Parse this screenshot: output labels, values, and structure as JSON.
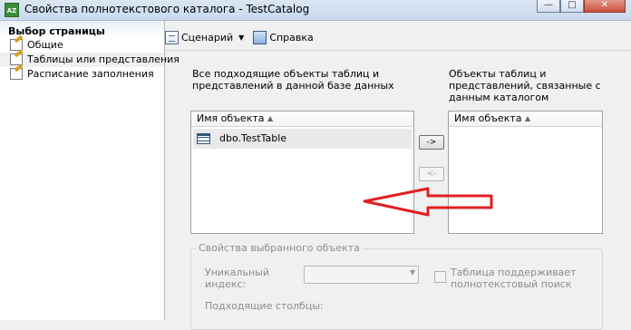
{
  "window": {
    "title": "Свойства полнотекстового каталога - TestCatalog",
    "app_icon_text": "AZ",
    "minimize_glyph": "—",
    "maximize_glyph": "□",
    "close_glyph": "✕"
  },
  "sidebar": {
    "header": "Выбор страницы",
    "items": [
      {
        "label": "Общие",
        "icon": "page-icon"
      },
      {
        "label": "Таблицы или представления",
        "icon": "page-icon",
        "selected": true
      },
      {
        "label": "Расписание заполнения",
        "icon": "page-icon"
      }
    ]
  },
  "toolbar": {
    "script_label": "Сценарий",
    "script_dropdown_glyph": "▼",
    "help_label": "Справка"
  },
  "available": {
    "caption": "Все подходящие объекты таблиц и представлений в данной базе данных",
    "caption_lines": [
      "Все подходящие объекты таблиц и",
      "представлений в данной базе данных"
    ],
    "column_header": "Имя объекта",
    "sort_glyph": "▲",
    "rows": [
      {
        "name": "dbo.TestTable",
        "icon": "table-icon"
      }
    ]
  },
  "assigned": {
    "caption_lines": [
      "Объекты таблиц и",
      "представлений, связанные с",
      "данным каталогом"
    ],
    "column_header": "Имя объекта",
    "sort_glyph": "▲",
    "rows": []
  },
  "buttons": {
    "add_label": "->",
    "remove_label": "<-"
  },
  "selected_object": {
    "group_title": "Свойства выбранного объекта",
    "unique_index_label_lines": [
      "Уникальный",
      "индекс:"
    ],
    "unique_index_value": "",
    "combo_glyph": "▼",
    "supports_fulltext_lines": [
      "Таблица поддерживает",
      "полнотекстовый поиск"
    ],
    "supports_fulltext_checked": false,
    "eligible_columns_label": "Подходящие столбцы:"
  },
  "colors": {
    "annotation_arrow": "#e02020"
  }
}
